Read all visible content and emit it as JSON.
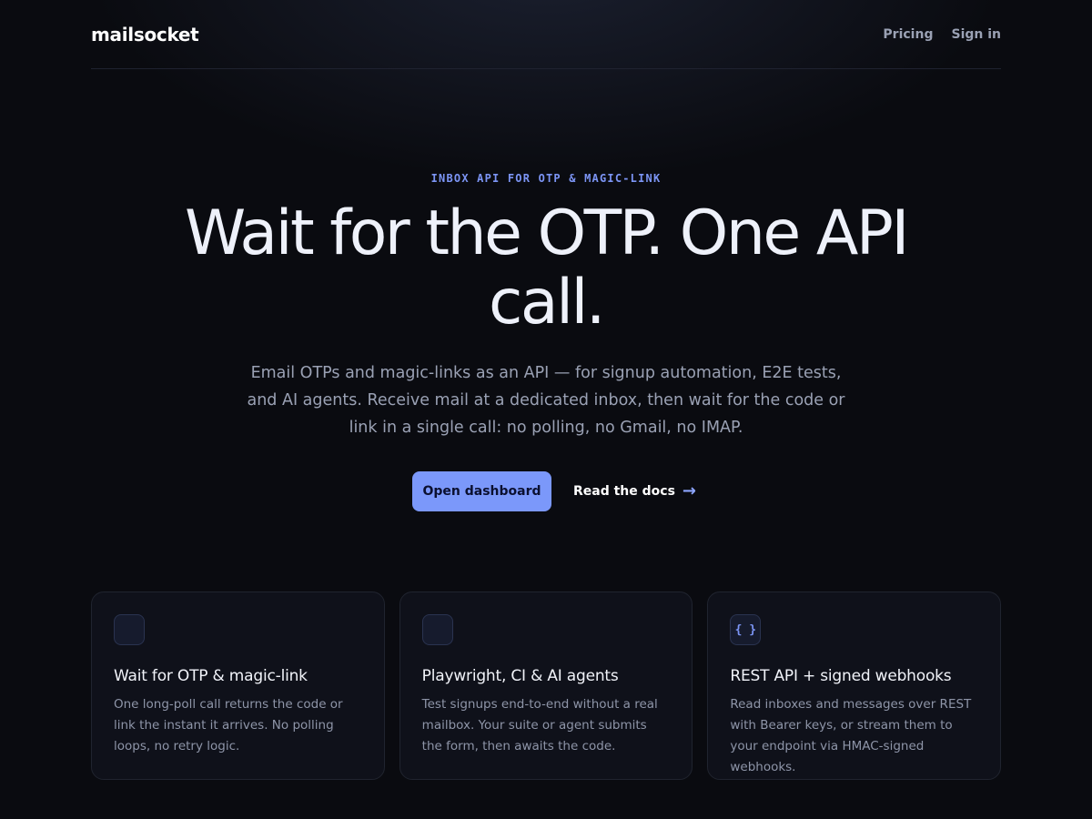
{
  "header": {
    "brand": "mailsocket",
    "nav": [
      {
        "label": "Pricing"
      },
      {
        "label": "Sign in"
      }
    ]
  },
  "hero": {
    "eyebrow": "INBOX API FOR OTP & MAGIC-LINK",
    "headline": "Wait for the OTP. One API call.",
    "subtitle": "Email OTPs and magic-links as an API — for signup automation, E2E tests, and AI agents. Receive mail at a dedicated inbox, then wait for the code or link in a single call: no polling, no Gmail, no IMAP.",
    "primary_cta": "Open dashboard",
    "secondary_cta": "Read the docs",
    "secondary_cta_arrow": "→"
  },
  "features": [
    {
      "icon": "blank-icon",
      "icon_text": "",
      "title": "Wait for OTP & magic-link",
      "text": "One long-poll call returns the code or link the instant it arrives. No polling loops, no retry logic."
    },
    {
      "icon": "blank-icon",
      "icon_text": "",
      "title": "Playwright, CI & AI agents",
      "text": "Test signups end-to-end without a real mailbox. Your suite or agent submits the form, then awaits the code."
    },
    {
      "icon": "code-braces-icon",
      "icon_text": "{ }",
      "title": "REST API + signed webhooks",
      "text": "Read inboxes and messages over REST with Bearer keys, or stream them to your endpoint via HMAC-signed webhooks."
    }
  ],
  "colors": {
    "background": "#0a0b10",
    "accent": "#7b98fa",
    "eyebrow": "#7c95f5",
    "muted_text": "#9aa1b4",
    "card_bg": "#0f111a",
    "card_border": "#20242f"
  }
}
